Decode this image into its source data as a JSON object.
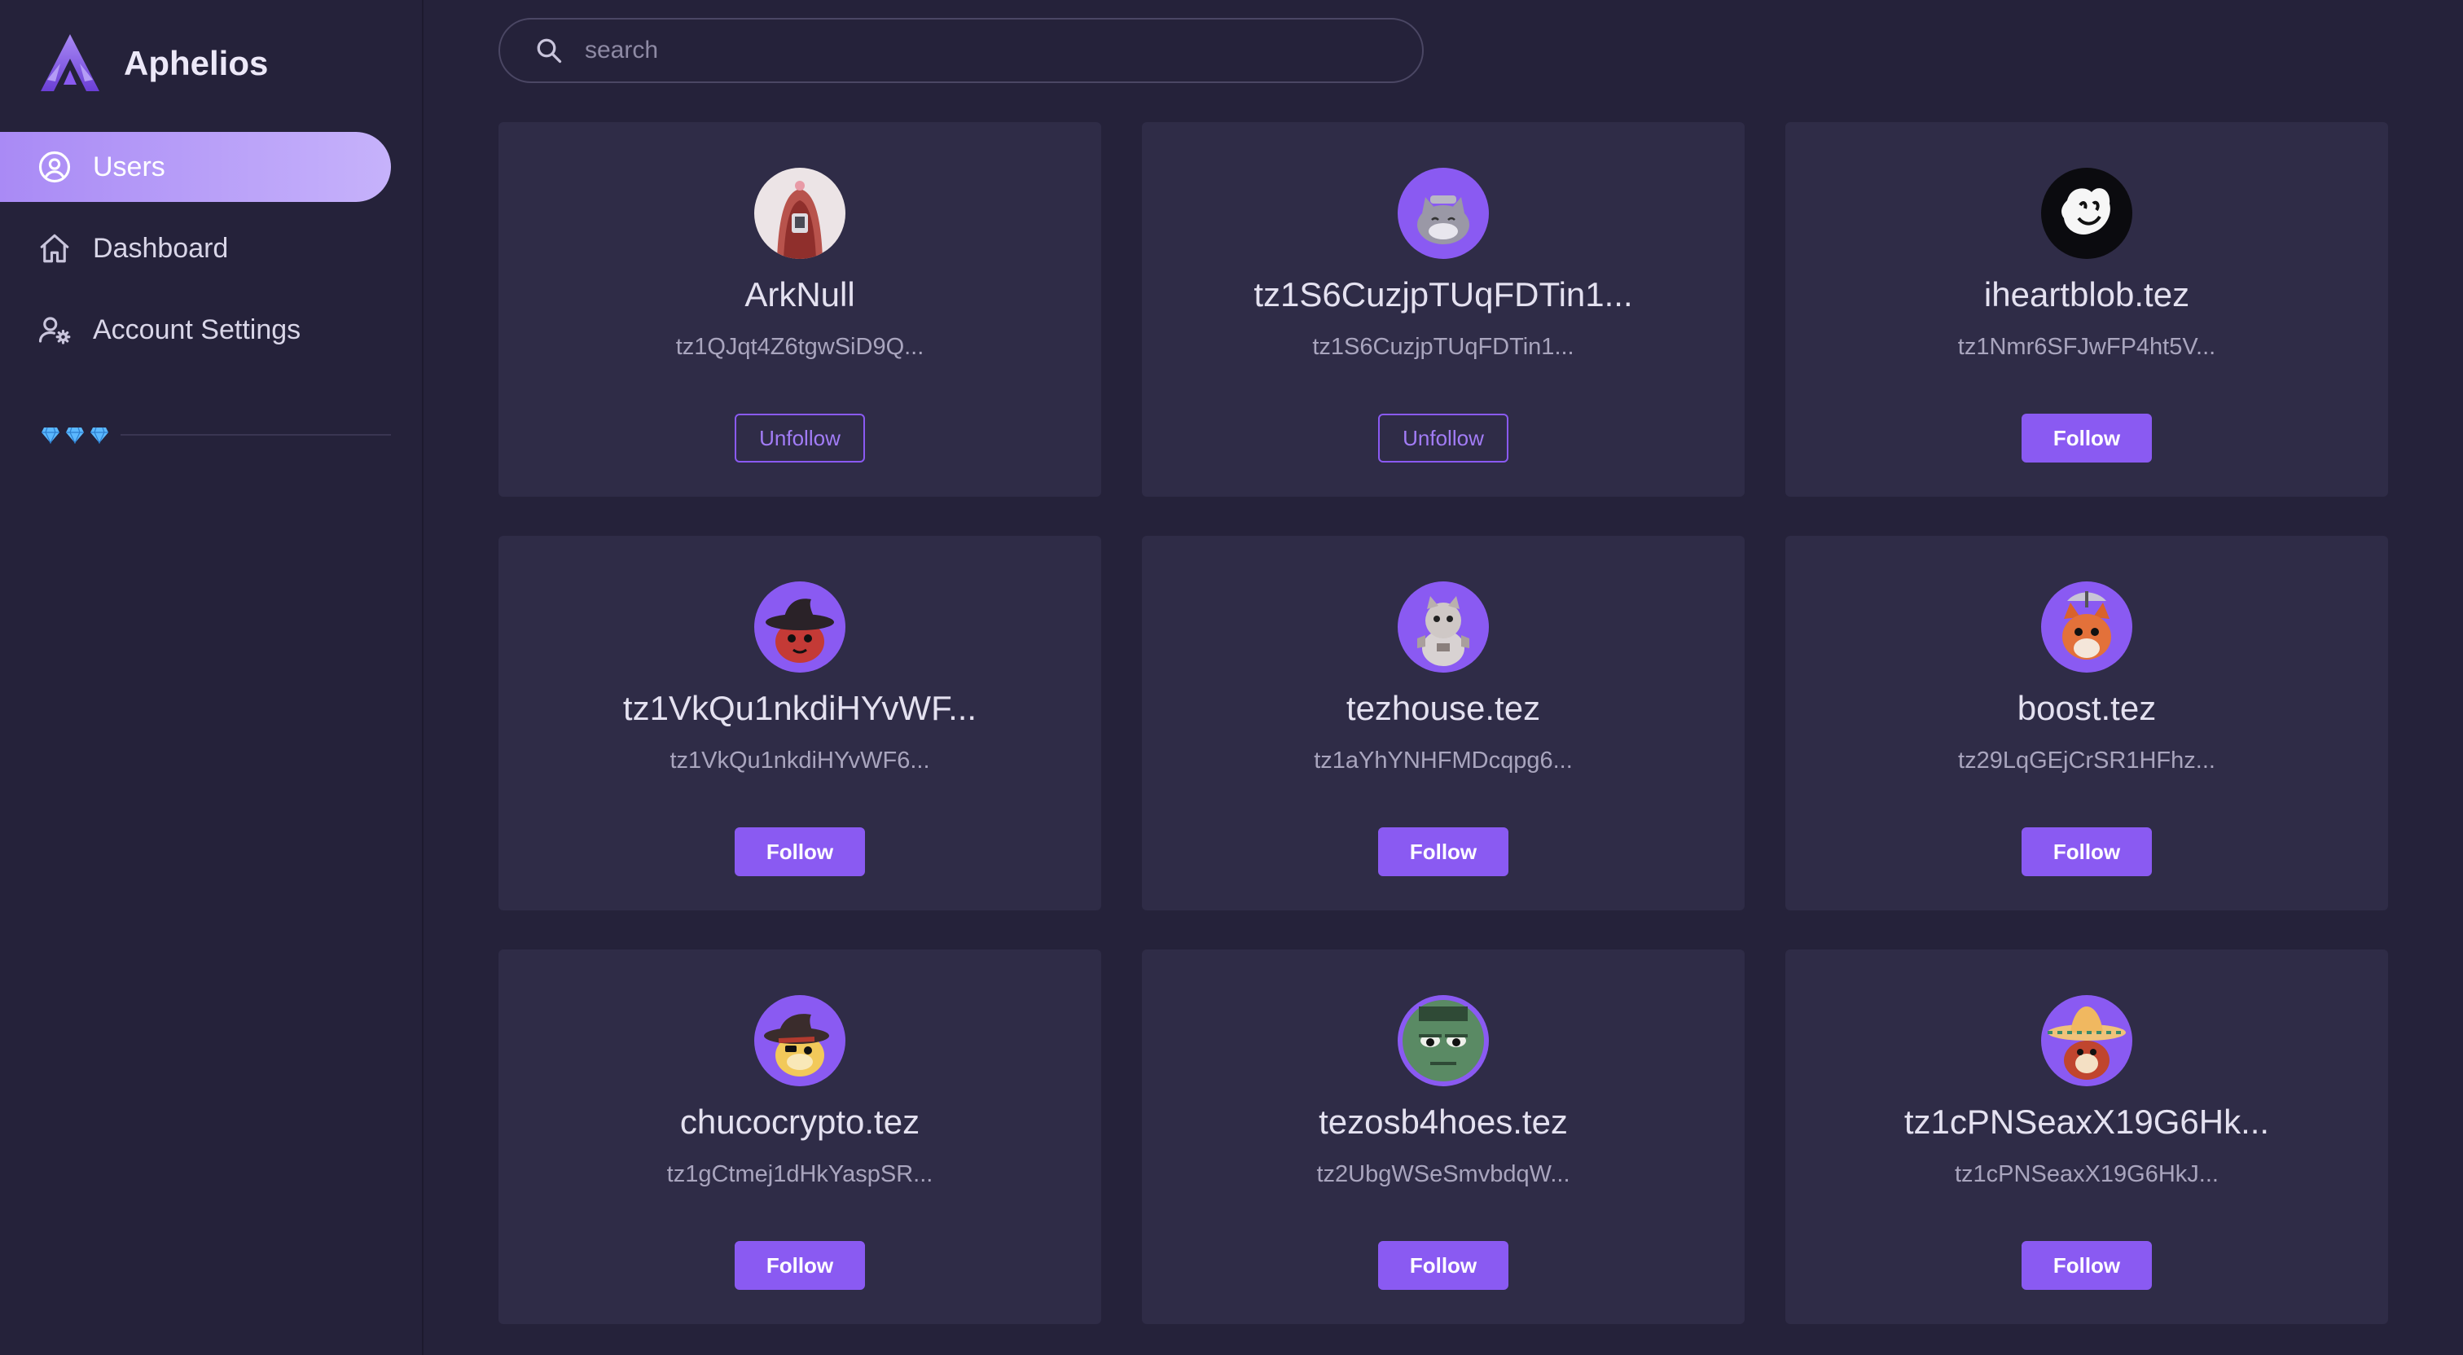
{
  "app": {
    "name": "Aphelios"
  },
  "colors": {
    "accent": "#8a5af2",
    "background": "#25223a",
    "card": "#2f2c47"
  },
  "sidebar": {
    "items": [
      {
        "label": "Users",
        "icon": "user-circle-icon",
        "active": true
      },
      {
        "label": "Dashboard",
        "icon": "home-icon",
        "active": false
      },
      {
        "label": "Account Settings",
        "icon": "user-gear-icon",
        "active": false
      }
    ],
    "gems": "💎💎💎"
  },
  "search": {
    "placeholder": "search",
    "value": ""
  },
  "users": [
    {
      "name": "ArkNull",
      "address": "tz1QJqt4Z6tgwSiD9Q...",
      "button": "Unfollow",
      "avatar": "red-hood-avatar"
    },
    {
      "name": "tz1S6CuzjpTUqFDTin1...",
      "address": "tz1S6CuzjpTUqFDTin1...",
      "button": "Unfollow",
      "avatar": "gray-cat-avatar"
    },
    {
      "name": "iheartblob.tez",
      "address": "tz1Nmr6SFJwFP4ht5V...",
      "button": "Follow",
      "avatar": "blob-avatar"
    },
    {
      "name": "tz1VkQu1nkdiHYvWF...",
      "address": "tz1VkQu1nkdiHYvWF6...",
      "button": "Follow",
      "avatar": "witch-hat-avatar"
    },
    {
      "name": "tezhouse.tez",
      "address": "tz1aYhYNHFMDcqpg6...",
      "button": "Follow",
      "avatar": "robot-bear-avatar"
    },
    {
      "name": "boost.tez",
      "address": "tz29LqGEjCrSR1HFhz...",
      "button": "Follow",
      "avatar": "fox-avatar"
    },
    {
      "name": "chucocrypto.tez",
      "address": "tz1gCtmej1dHkYaspSR...",
      "button": "Follow",
      "avatar": "pirate-hat-avatar"
    },
    {
      "name": "tezosb4hoes.tez",
      "address": "tz2UbgWSeSmvbdqW...",
      "button": "Follow",
      "avatar": "green-monster-avatar"
    },
    {
      "name": "tz1cPNSeaxX19G6Hk...",
      "address": "tz1cPNSeaxX19G6HkJ...",
      "button": "Follow",
      "avatar": "sombrero-avatar"
    }
  ]
}
